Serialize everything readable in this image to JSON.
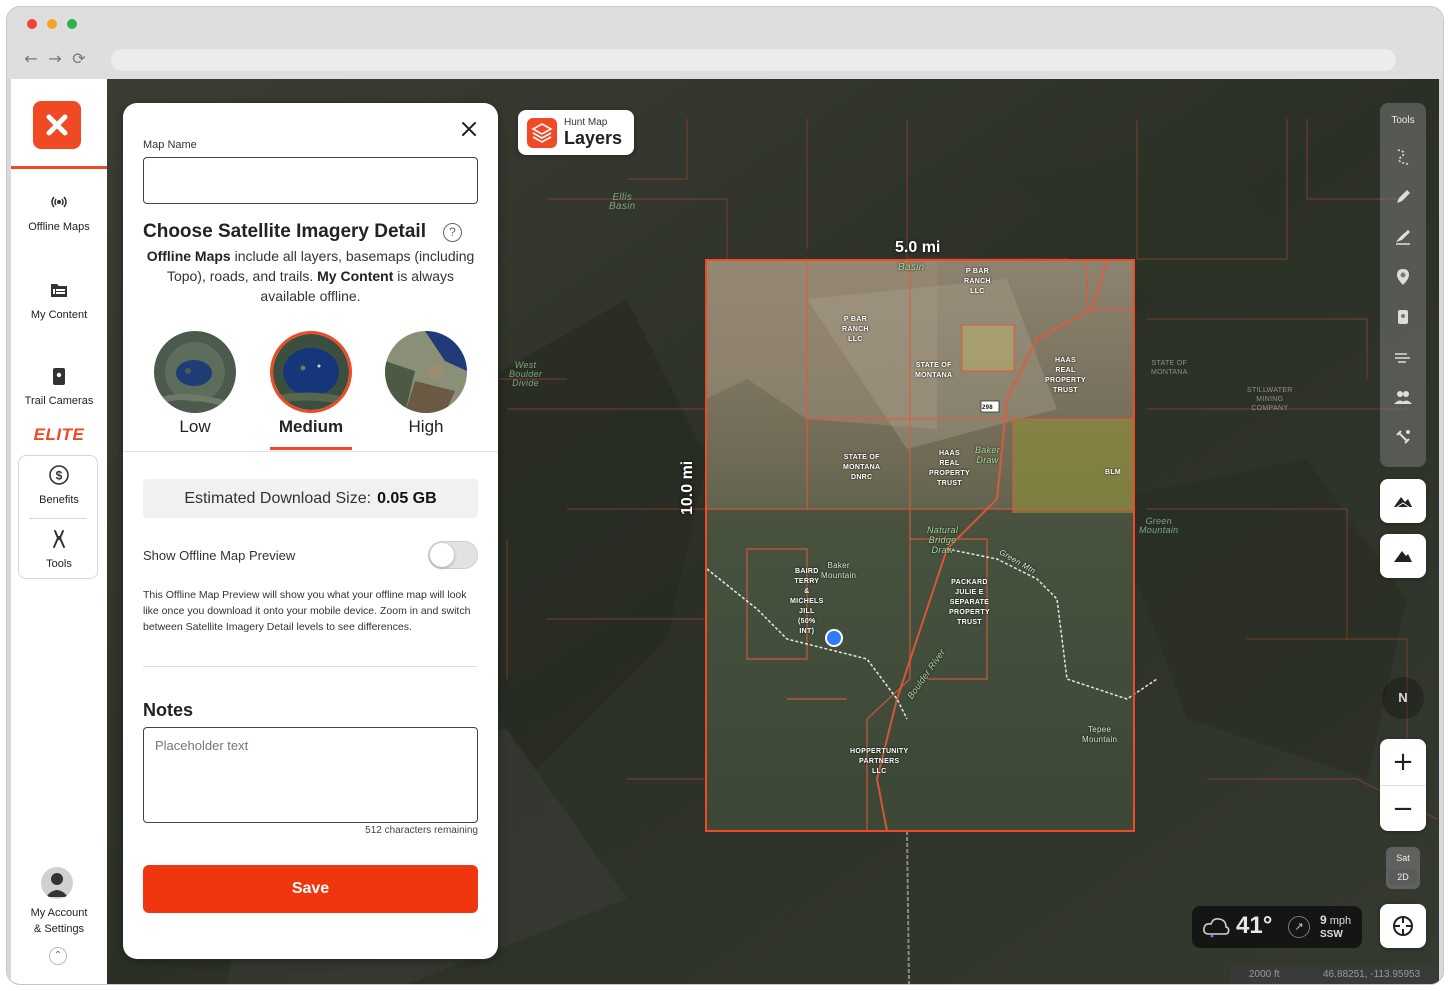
{
  "sidebar": {
    "items": [
      {
        "label": "Offline Maps",
        "icon": "broadcast-icon"
      },
      {
        "label": "My Content",
        "icon": "folder-icon"
      },
      {
        "label": "Trail Cameras",
        "icon": "trail-camera-icon"
      }
    ],
    "elite_label": "ELITE",
    "elite_items": [
      {
        "label": "Benefits",
        "icon": "dollar-icon"
      },
      {
        "label": "Tools",
        "icon": "tools-icon"
      }
    ],
    "account_label_1": "My Account",
    "account_label_2": "& Settings"
  },
  "panel": {
    "map_name_label": "Map Name",
    "map_name_value": "",
    "section_title": "Choose Satellite Imagery Detail",
    "desc_b1": "Offline Maps",
    "desc_t1": " include all layers, basemaps (including Topo), roads, and trails. ",
    "desc_b2": "My Content",
    "desc_t2": " is always available offline.",
    "detail_levels": [
      "Low",
      "Medium",
      "High"
    ],
    "selected_level": "Medium",
    "est_label": "Estimated Download Size:",
    "est_value": "0.05 GB",
    "preview_label": "Show Offline Map Preview",
    "preview_on": false,
    "preview_desc": "This Offline Map Preview will show you what your offline map will look like once you download it onto your mobile device. Zoom in and switch between Satellite Imagery Detail levels to see differences.",
    "notes_title": "Notes",
    "notes_placeholder": "Placeholder text",
    "chars_remaining": "512 characters remaining",
    "save_label": "Save"
  },
  "layers_button": {
    "small": "Hunt Map",
    "big": "Layers"
  },
  "tools": {
    "title": "Tools"
  },
  "map": {
    "width_label": "5.0 mi",
    "height_label": "10.0 mi",
    "compass": "N",
    "sat_label": "Sat",
    "mode_label": "2D",
    "weather": {
      "temp": "41°",
      "wind_speed": "9",
      "wind_unit": "mph",
      "wind_dir": "SSW"
    },
    "scale": "2000 ft",
    "coords": "46.88251, -113.95953",
    "route": "298",
    "labels": {
      "pbar1": "P BAR\nRANCH\nLLC",
      "pbar2": "P BAR\nRANCH\nLLC",
      "state1": "STATE OF\nMONTANA",
      "haas1": "HAAS\nREAL\nPROPERTY\nTRUST",
      "state2": "STATE OF\nMONTANA\nDNRC",
      "haas2": "HAAS\nREAL\nPROPERTY\nTRUST",
      "blm": "BLM",
      "baird": "BAIRD\nTERRY\n&\nMICHELS\nJILL\n(50%\nINT)",
      "baker": "Baker\nMountain",
      "packard": "PACKARD\nJULIE E\nSEPARATE\nPROPERTY\nTRUST",
      "hopper": "HOPPERTUNITY\nPARTNERS\nLLC",
      "tepee": "Tepee\nMountain",
      "basin": "Basin",
      "natural_bridge": "Natural\nBridge\nDraw",
      "baker_draw": "Baker\nDraw",
      "boulder_river": "Boulder River",
      "green_mtn": "Green Mtn",
      "ellis": "Ellis\nBasin",
      "west_boulder": "West\nBoulder\nDivide",
      "green_mountain": "Green\nMountain",
      "stillwater": "STILLWATER\nMINING\nCOMPANY",
      "state3": "STATE OF\nMONTANA"
    }
  }
}
